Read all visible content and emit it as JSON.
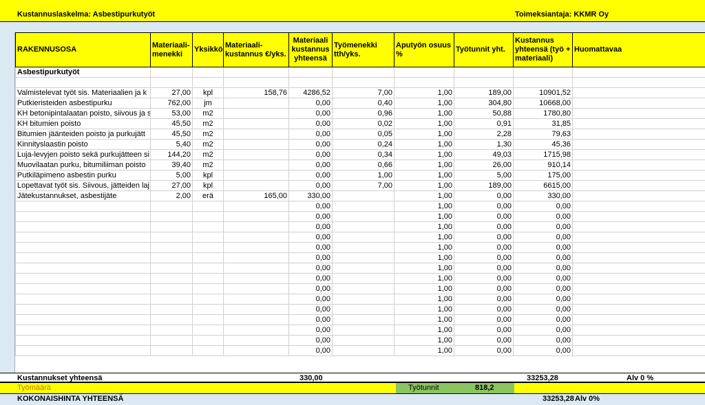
{
  "header": {
    "title": "Kustannuslaskelma: Asbestipurkutyöt",
    "client": "Toimeksiantaja: KKMR Oy"
  },
  "columns": {
    "rakennusosa": "RAKENNUSOSA",
    "menekki": "Materiaali-menekki",
    "yksikko": "Yksikkö",
    "kustannus_yks": "Materiaali-kustannus €/yks.",
    "kustannus_yht": "Materiaali kustannus yhteensä",
    "tyomenekki": "Työmenekki tth/yks.",
    "aputyo": "Aputyön osuus %",
    "tyotunnit": "Työtunnit yht.",
    "kustannus_total": "Kustannus yhteensä (työ + materiaali)",
    "huom": "Huomattavaa"
  },
  "section": "Asbestipurkutyöt",
  "rows": [
    {
      "name": "Valmistelevat työt sis. Materiaalien ja k",
      "menekki": "27,00",
      "yks": "kpl",
      "kust": "158,76",
      "kust_yht": "4286,52",
      "tyo": "7,00",
      "apu": "1,00",
      "tunnit": "189,00",
      "total": "10901,52"
    },
    {
      "name": "Putkieristeiden asbestipurku",
      "menekki": "762,00",
      "yks": "jm",
      "kust": "",
      "kust_yht": "0,00",
      "tyo": "0,40",
      "apu": "1,00",
      "tunnit": "304,80",
      "total": "10668,00"
    },
    {
      "name": "KH betonipintalaatan poisto, siivous ja s",
      "menekki": "53,00",
      "yks": "m2",
      "kust": "",
      "kust_yht": "0,00",
      "tyo": "0,96",
      "apu": "1,00",
      "tunnit": "50,88",
      "total": "1780,80"
    },
    {
      "name": "KH bitumien poisto",
      "menekki": "45,50",
      "yks": "m2",
      "kust": "",
      "kust_yht": "0,00",
      "tyo": "0,02",
      "apu": "1,00",
      "tunnit": "0,91",
      "total": "31,85"
    },
    {
      "name": "Bitumien jäänteiden poisto ja purkujätt",
      "menekki": "45,50",
      "yks": "m2",
      "kust": "",
      "kust_yht": "0,00",
      "tyo": "0,05",
      "apu": "1,00",
      "tunnit": "2,28",
      "total": "79,63"
    },
    {
      "name": "Kinnityslaastin poisto",
      "menekki": "5,40",
      "yks": "m2",
      "kust": "",
      "kust_yht": "0,00",
      "tyo": "0,24",
      "apu": "1,00",
      "tunnit": "1,30",
      "total": "45,36"
    },
    {
      "name": "Luja-levyjen poisto sekä purkujätteen si",
      "menekki": "144,20",
      "yks": "m2",
      "kust": "",
      "kust_yht": "0,00",
      "tyo": "0,34",
      "apu": "1,00",
      "tunnit": "49,03",
      "total": "1715,98"
    },
    {
      "name": "Muovilaatan purku, bitumiliiman poisto",
      "menekki": "39,40",
      "yks": "m2",
      "kust": "",
      "kust_yht": "0,00",
      "tyo": "0,66",
      "apu": "1,00",
      "tunnit": "26,00",
      "total": "910,14"
    },
    {
      "name": "Putkiläpimeno asbestin purku",
      "menekki": "5,00",
      "yks": "kpl",
      "kust": "",
      "kust_yht": "0,00",
      "tyo": "1,00",
      "apu": "1,00",
      "tunnit": "5,00",
      "total": "175,00"
    },
    {
      "name": "Lopettavat työt sis. Siivous, jätteiden laj",
      "menekki": "27,00",
      "yks": "kpl",
      "kust": "",
      "kust_yht": "0,00",
      "tyo": "7,00",
      "apu": "1,00",
      "tunnit": "189,00",
      "total": "6615,00"
    },
    {
      "name": "Jätekustannukset, asbestijäte",
      "menekki": "2,00",
      "yks": "erä",
      "kust": "165,00",
      "kust_yht": "330,00",
      "tyo": "",
      "apu": "1,00",
      "tunnit": "0,00",
      "total": "330,00"
    }
  ],
  "empty_row": {
    "kust_yht": "0,00",
    "apu": "1,00",
    "tunnit": "0,00",
    "total": "0,00"
  },
  "empty_row_count": 15,
  "totals": {
    "label": "Kustannukset yhteensä",
    "material_total": "330,00",
    "grand": "33253,28",
    "alv": "Alv 0 %"
  },
  "work": {
    "label": "Työmäärä",
    "hours_label": "Työtunnit",
    "hours": "818,2"
  },
  "grand": {
    "label": "KOKONAISHINTA YHTEENSÄ",
    "value": "33253,28",
    "alv": "Alv 0%"
  },
  "colors": {
    "header_yellow": "#ffff00",
    "light_blue": "#dbe9f3",
    "green": "#8cc460",
    "work_label": "#c08000"
  }
}
